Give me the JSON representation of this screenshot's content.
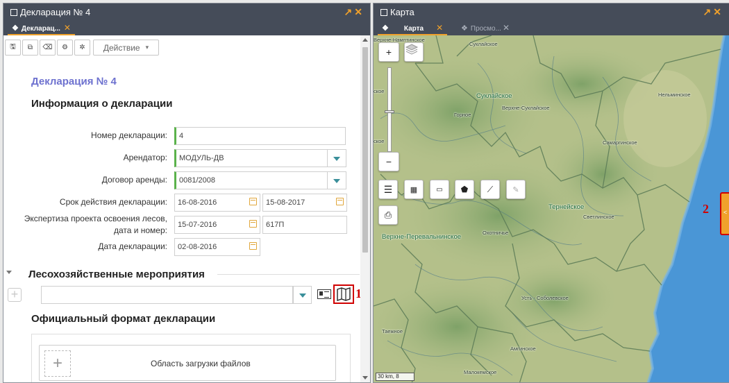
{
  "left_panel": {
    "title": "Декларация № 4",
    "tab_label": "Декларац...",
    "window_icon": "window-restore-icon",
    "controls": {
      "expand": "↗",
      "close": "✕"
    }
  },
  "toolbar": {
    "buttons": [
      "save-icon",
      "copy-icon",
      "eraser-icon",
      "gears-icon",
      "gear-icon"
    ],
    "action_label": "Действие"
  },
  "form": {
    "heading": "Декларация № 4",
    "info_heading": "Информация о декларации",
    "fields": {
      "number": {
        "label": "Номер декларации:",
        "value": "4"
      },
      "tenant": {
        "label": "Арендатор:",
        "value": "МОДУЛЬ-ДВ"
      },
      "lease": {
        "label": "Договор аренды:",
        "value": "0081/2008"
      },
      "term": {
        "label": "Срок действия декларации:",
        "from": "16-08-2016",
        "to": "15-08-2017"
      },
      "expertise": {
        "label_line1": "Экспертиза проекта освоения лесов,",
        "label_line2": "дата и номер:",
        "date": "15-07-2016",
        "number": "617П"
      },
      "date": {
        "label": "Дата декларации:",
        "value": "02-08-2016"
      }
    }
  },
  "sections": {
    "forestry": "Лесохозяйственные мероприятия",
    "official_format": "Официальный формат декларации",
    "upload_text": "Область загрузки файлов"
  },
  "callouts": {
    "one": "1",
    "two": "2"
  },
  "right_panel": {
    "title": "Карта",
    "tabs": [
      {
        "label": "Карта",
        "active": true
      },
      {
        "label": "Просмо...",
        "active": false
      }
    ],
    "controls": {
      "expand": "↗",
      "close": "✕"
    }
  },
  "map": {
    "zoom_in": "+",
    "zoom_out": "−",
    "scale": "30 km, 8",
    "labels": {
      "suklaiskoe": "Суклайское",
      "suklaiskoe_top": "Суклайское",
      "verkhne_suklaiskoe": "Верхне-Суклайское",
      "gornoe": "Горное",
      "nelminskoe": "Нельминское",
      "samarginskoe": "Самаргинское",
      "terneiskoe": "Тернейское",
      "svetlinskoe": "Светлинское",
      "okhotnichie": "Охотничье",
      "verkhne_perevalninskoe": "Верхне-Перевальнинское",
      "ust_sobolevskoe": "Усть - Соболевское",
      "taezhnoe": "Таежное",
      "amginskoe": "Амгинское",
      "malokemskoe": "Малокемское",
      "verkhne_namt": "Верхне-Намптинское",
      "left_edge_1": "ское",
      "left_edge_2": "ское"
    }
  }
}
